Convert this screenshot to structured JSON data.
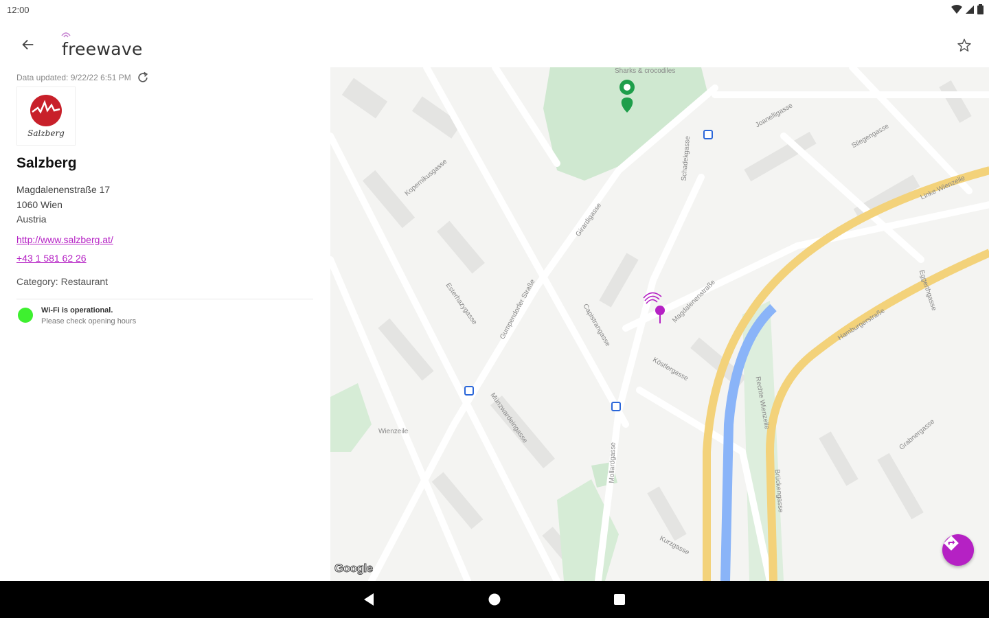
{
  "status_bar": {
    "time": "12:00"
  },
  "app_bar": {
    "logo_text": "freewave"
  },
  "venue": {
    "data_updated": "Data updated: 9/22/22 6:51 PM",
    "logo_text": "Salzberg",
    "name": "Salzberg",
    "address_line1": "Magdalenenstraße 17",
    "address_line2": "1060 Wien",
    "address_line3": "Austria",
    "website": "http://www.salzberg.at/",
    "phone": "+43 1 581 62 26",
    "category": "Category: Restaurant",
    "wifi_status_title": "Wi-Fi is operational.",
    "wifi_status_sub": "Please check opening hours",
    "wifi_status_color": "#3ef02f"
  },
  "map": {
    "attribution": "Google",
    "labels": {
      "park": "Sharks & crocodiles",
      "s1": "Gumpendorfer Straße",
      "s2": "Esterhazygasse",
      "s3": "Münzwardeingasse",
      "s4": "Magdalenenstraße",
      "s5": "Linke Wienzeile",
      "s6": "Hamburgerstraße",
      "s7": "Rechte Wienzeile",
      "s8": "Mollardgasse",
      "s9": "Köstlergasse",
      "s10": "Kurzgasse",
      "s11": "Capistrangasse",
      "s12": "Brückengasse",
      "s13": "Girardigasse",
      "s14": "Schadekgasse",
      "s15": "Kopernikusgasse",
      "s16": "Eggerthgasse",
      "s17": "Grabnergasse",
      "s18": "Joanelligasse",
      "s19": "Stiegengasse",
      "s20": "Wienzeile"
    },
    "accent_color": "#b521c4"
  }
}
